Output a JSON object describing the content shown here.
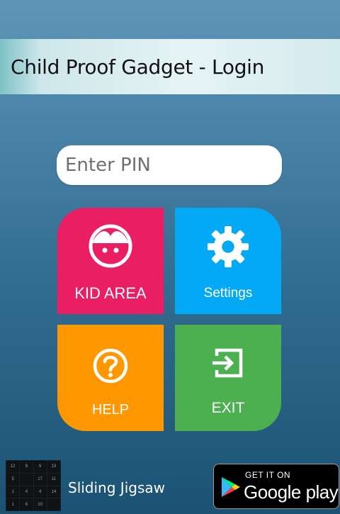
{
  "header": {
    "title": "Child Proof Gadget - Login"
  },
  "pin": {
    "placeholder": "Enter PIN",
    "value": ""
  },
  "tiles": {
    "kid_area": {
      "label": "KID AREA",
      "color": "#e91e63",
      "icon": "face-icon"
    },
    "settings": {
      "label": "Settings",
      "color": "#03a9f4",
      "icon": "gear-icon"
    },
    "help": {
      "label": "HELP",
      "color": "#ff9800",
      "icon": "help-circle-icon"
    },
    "exit": {
      "label": "EXIT",
      "color": "#4caf50",
      "icon": "exit-icon"
    }
  },
  "footer": {
    "app_name": "Sliding Jigsaw",
    "puzzle_numbers": [
      "12",
      "8",
      "9",
      "13",
      "5",
      "",
      "17",
      "11",
      "1",
      "4",
      "4",
      "14",
      "1",
      "6",
      "10",
      ""
    ],
    "store_badge": {
      "line1": "GET IT ON",
      "line2": "Google play"
    }
  },
  "colors": {
    "background_top": "#5f95b8",
    "background_bottom": "#1b5273"
  }
}
